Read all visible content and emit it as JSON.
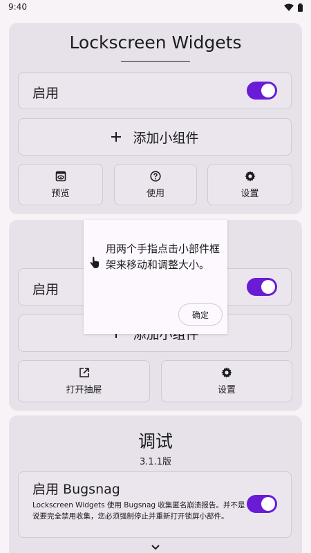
{
  "status": {
    "time": "9:40"
  },
  "widgets_card": {
    "title": "Lockscreen Widgets",
    "enable_label": "启用",
    "enabled": true,
    "add_label": "添加小组件",
    "buttons": [
      {
        "label": "预览",
        "icon": "preview-icon"
      },
      {
        "label": "使用",
        "icon": "help-icon"
      },
      {
        "label": "设置",
        "icon": "gear-icon"
      }
    ]
  },
  "drawer_card": {
    "enable_label": "启用",
    "enabled": true,
    "add_label": "添加小组件",
    "buttons": [
      {
        "label": "打开抽屉",
        "icon": "open-external-icon"
      },
      {
        "label": "设置",
        "icon": "gear-icon"
      }
    ]
  },
  "debug_card": {
    "title": "调试",
    "version": "3.1.1版",
    "bugsnag_label": "启用 Bugsnag",
    "bugsnag_desc": "Lockscreen Widgets 使用 Bugsnag 收集匿名崩溃报告。并不是说要完全禁用收集，您必须强制停止并重新打开锁屏小部件。",
    "bugsnag_enabled": true
  },
  "dialog": {
    "message": "用两个手指点击小部件框架来移动和调整大小。",
    "confirm_label": "确定",
    "icon": "touch-hand-icon"
  },
  "colors": {
    "accent": "#6a1bd6",
    "card": "#e7e2e9",
    "background": "#f7f3f7"
  }
}
